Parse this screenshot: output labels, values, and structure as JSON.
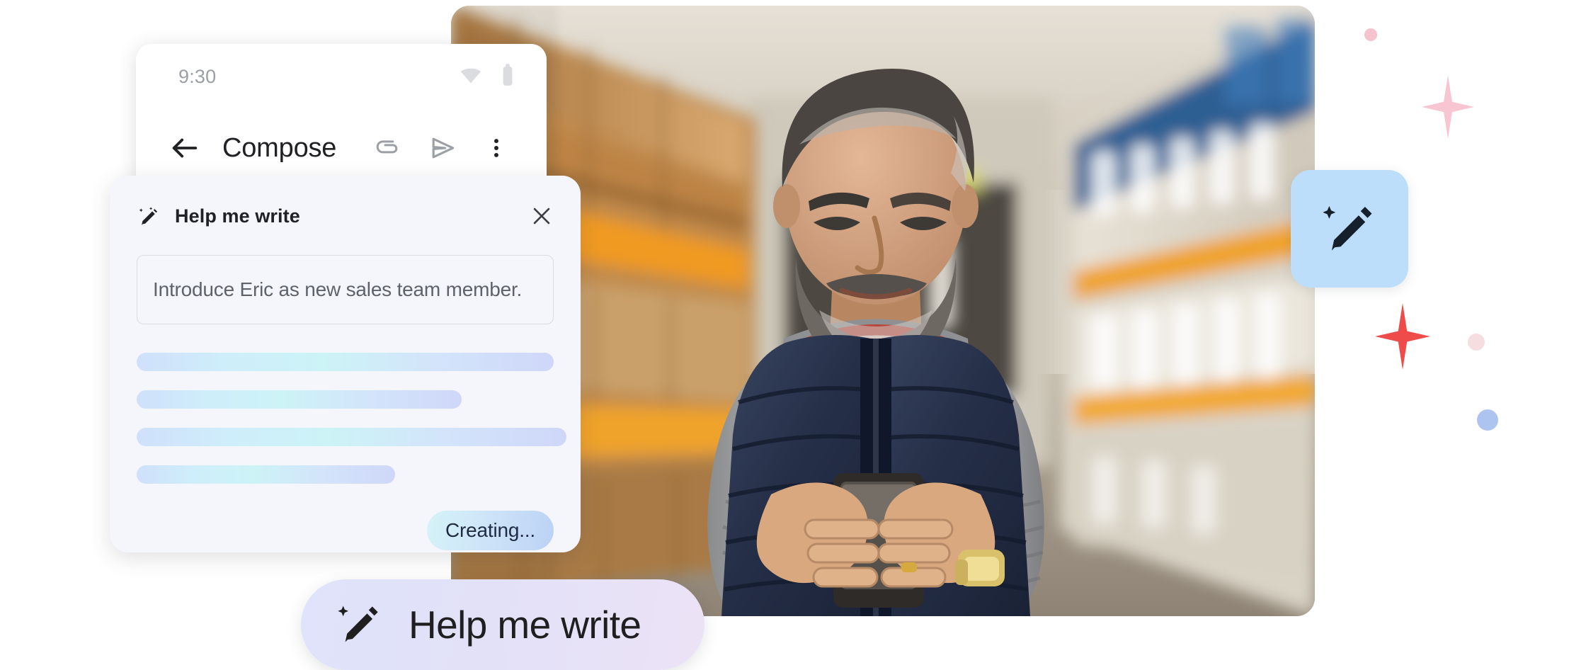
{
  "phone": {
    "status_bar": {
      "clock": "9:30",
      "wifi_icon": "wifi-icon",
      "battery_icon": "battery-icon"
    },
    "compose": {
      "back_icon": "back-arrow-icon",
      "title": "Compose",
      "attach_icon": "paperclip-icon",
      "send_icon": "send-icon",
      "more_icon": "more-vertical-icon"
    }
  },
  "help_me_write": {
    "wand_icon": "magic-pencil-icon",
    "title": "Help me write",
    "close_icon": "close-icon",
    "prompt": {
      "value": "Introduce Eric as new sales team member.",
      "placeholder": "Introduce Eric as new sales team member."
    },
    "skeleton_widths": [
      100,
      78,
      103,
      62
    ],
    "create_button": "Creating..."
  },
  "floating_chip": {
    "icon": "magic-pencil-icon"
  },
  "bottom_pill": {
    "icon": "magic-pencil-icon",
    "label": "Help me write"
  },
  "photo": {
    "alt": "Man in warehouse aisle holding a smartphone",
    "description": "Bearded man in navy puffer vest over grey sweater standing in a warehouse aisle with orange racking and cardboard boxes, looking down at his phone"
  },
  "decorations": [
    {
      "name": "pink-dot-small",
      "shape": "circle"
    },
    {
      "name": "pink-sparkle",
      "shape": "star4"
    },
    {
      "name": "red-sparkle",
      "shape": "star4"
    },
    {
      "name": "pink-dot-faint",
      "shape": "circle"
    },
    {
      "name": "blue-dot",
      "shape": "circle"
    }
  ],
  "colors": {
    "page_background": "#ffffff",
    "card_background": "#f4f6fc",
    "compose_background": "#ffffff",
    "chip_blue": "#bcdefb",
    "pill_gradient_start": "#dfe3fb",
    "pill_gradient_end": "#ece2f6",
    "creating_gradient_start": "#d4f3f7",
    "creating_gradient_end": "#bcd2f6",
    "text_primary": "#202124",
    "text_secondary": "#5f6368",
    "status_icon": "#dadce0",
    "sparkle_pink": "#f8c9d4",
    "sparkle_red": "#ef4b4b",
    "dot_blue": "#aec4f0",
    "skeleton_start": "#cfe0fb",
    "skeleton_mid": "#ccf3f6"
  }
}
